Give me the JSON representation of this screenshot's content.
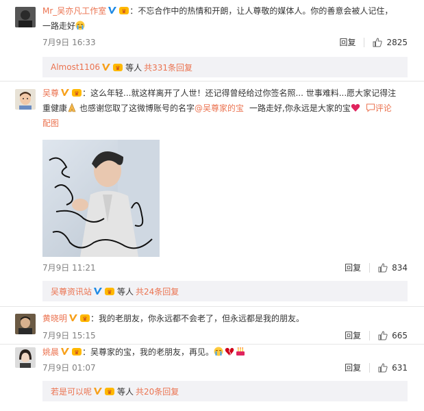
{
  "comments": [
    {
      "name": "Mr_吴亦凡工作室",
      "colon": "：",
      "text_line1": "不忘合作中的热情和开朗，让人尊敬的媒体人。你的善意会被人记住，",
      "text_line2": "一路走好",
      "time": "7月9日 16:33",
      "reply_label": "回复",
      "likes": "2825",
      "sub": {
        "name": "Almost1106",
        "suffix": "等人",
        "count_text": "共331条回复"
      }
    },
    {
      "name": "吴尊",
      "colon": "：",
      "text_line1": "这么年轻...就这样离开了人世！还记得曾经给过你签名照... 世事难料...愿大家记得注",
      "text_line2_a": "重健康",
      "text_line2_b": "也感谢您取了这微博账号的名字",
      "mention": "@吴尊家的宝",
      "text_line2_c": "一路走好,你永远是大家的宝",
      "comment_label": "评论",
      "pic_label": "配图",
      "time": "7月9日 11:21",
      "reply_label": "回复",
      "likes": "834",
      "sub": {
        "name": "吴尊资讯站",
        "suffix": "等人",
        "count_text": "共24条回复"
      }
    },
    {
      "name": "黄晓明",
      "colon": "：",
      "text": "我的老朋友，你永远都不会老了，但永远都是我的朋友。",
      "time": "7月9日 15:15",
      "reply_label": "回复",
      "likes": "665"
    },
    {
      "name": "姚晨",
      "colon": "：",
      "text": "吴尊家的宝，我的老朋友，再见。",
      "time": "7月9日 01:07",
      "reply_label": "回复",
      "likes": "631",
      "sub": {
        "name": "若是可以呢",
        "suffix": "等人",
        "count_text": "共20条回复"
      }
    }
  ],
  "colors": {
    "name": "#eb7350",
    "verified": "#1d8ae5",
    "reply_bg": "#f2f2f5"
  }
}
